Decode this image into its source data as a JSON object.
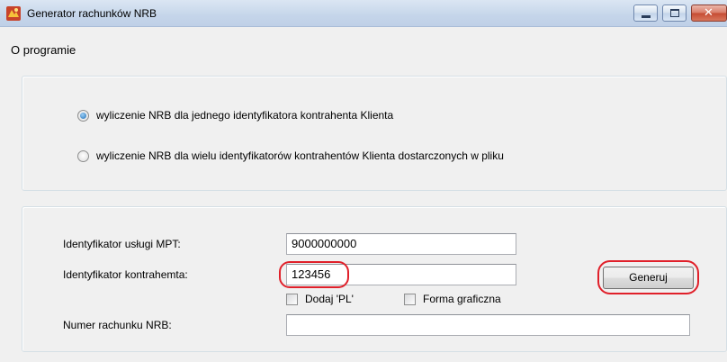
{
  "window": {
    "title": "Generator rachunków NRB",
    "icon": "app-icon",
    "controls": [
      "minimize-icon",
      "maximize-icon",
      "close-icon"
    ],
    "close_glyph": "✕"
  },
  "menu": {
    "items": [
      "O programie"
    ]
  },
  "mode": {
    "options": [
      {
        "label": "wyliczenie NRB dla jednego identyfikatora kontrahenta Klienta",
        "checked": true
      },
      {
        "label": "wyliczenie NRB dla wielu identyfikatorów kontrahentów Klienta dostarczonych w pliku",
        "checked": false
      }
    ]
  },
  "form": {
    "service_id_label": "Identyfikator usługi MPT:",
    "service_id_value": "9000000000",
    "contractor_id_label": "Identyfikator kontrahemta:",
    "contractor_id_value": "123456",
    "add_pl_label": "Dodaj 'PL'",
    "add_pl_checked": false,
    "graphic_form_label": "Forma graficzna",
    "graphic_form_checked": false,
    "nrb_label": "Numer rachunku NRB:",
    "nrb_value": "",
    "generate_label": "Generuj"
  },
  "colors": {
    "annotation": "#e0202a",
    "titlebar": "#c5d5ea"
  }
}
